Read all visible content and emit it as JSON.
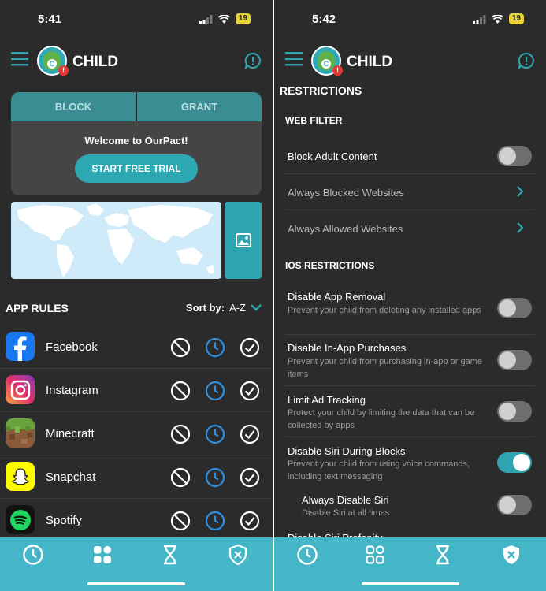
{
  "left": {
    "status": {
      "time": "5:41",
      "battery": "19"
    },
    "header": {
      "title": "CHILD",
      "avatar_letter": "C",
      "alert_mark": "!"
    },
    "card": {
      "tabs": [
        "BLOCK",
        "GRANT"
      ],
      "welcome": "Welcome to OurPact!",
      "trial_button": "START FREE TRIAL"
    },
    "app_rules": {
      "heading": "APP RULES",
      "sort_label": "Sort by:",
      "sort_value": "A-Z",
      "apps": [
        {
          "name": "Facebook",
          "icon": "facebook-icon"
        },
        {
          "name": "Instagram",
          "icon": "instagram-icon"
        },
        {
          "name": "Minecraft",
          "icon": "minecraft-icon"
        },
        {
          "name": "Snapchat",
          "icon": "snapchat-icon"
        },
        {
          "name": "Spotify",
          "icon": "spotify-icon"
        }
      ]
    },
    "nav": [
      "clock-icon",
      "apps-grid-icon",
      "hourglass-icon",
      "shield-x-icon"
    ]
  },
  "right": {
    "status": {
      "time": "5:42",
      "battery": "19"
    },
    "header": {
      "title": "CHILD",
      "avatar_letter": "C",
      "alert_mark": "!"
    },
    "heading": "RESTRICTIONS",
    "web_filter": {
      "heading": "WEB FILTER",
      "block_adult": {
        "label": "Block Adult Content",
        "on": false
      },
      "always_blocked": "Always Blocked Websites",
      "always_allowed": "Always Allowed Websites"
    },
    "ios": {
      "heading": "IOS RESTRICTIONS",
      "items": [
        {
          "label": "Disable App Removal",
          "sub": "Prevent your child from deleting any installed apps",
          "on": false
        },
        {
          "label": "Disable In-App Purchases",
          "sub": "Prevent your child from purchasing in-app or game items",
          "on": false
        },
        {
          "label": "Limit Ad Tracking",
          "sub": "Protect your child by limiting the data that can be collected by apps",
          "on": false
        },
        {
          "label": "Disable Siri During Blocks",
          "sub": "Prevent your child from using voice commands, including text messaging",
          "on": true
        },
        {
          "label": "Always Disable Siri",
          "sub": "Disable Siri at all times",
          "on": false
        }
      ],
      "cut_off_label": "Disable Siri Profanity"
    },
    "nav": [
      "clock-icon",
      "apps-grid-outline-icon",
      "hourglass-icon",
      "shield-x-icon"
    ]
  },
  "colors": {
    "accent": "#2ea5b0",
    "nav_bg": "#45b6c7",
    "background": "#2b2b2b",
    "alert": "#e53935"
  }
}
